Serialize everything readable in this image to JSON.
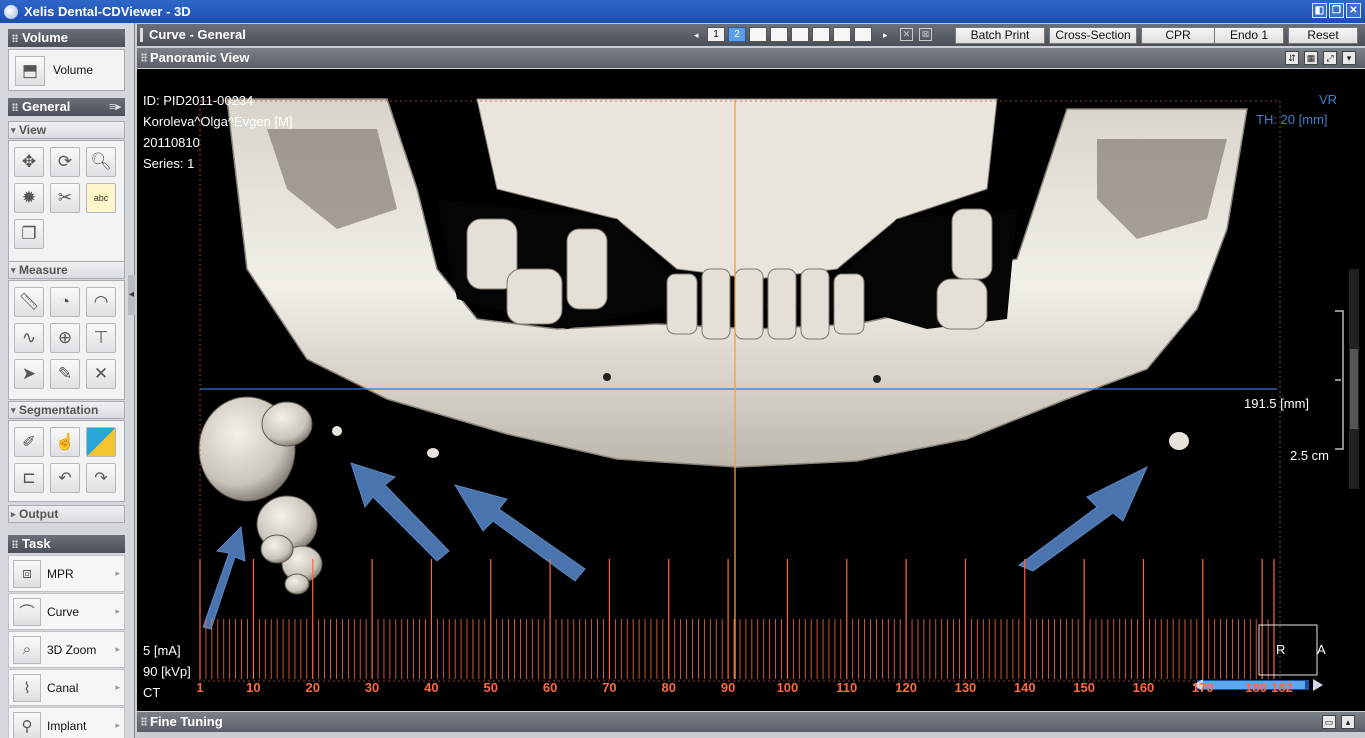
{
  "window": {
    "title": "Xelis Dental-CDViewer - 3D",
    "controls": [
      "◧",
      "❐",
      "✕"
    ]
  },
  "left_panel": {
    "volume_section": {
      "title": "Volume",
      "button_label": "Volume"
    },
    "general_section": {
      "title": "General",
      "view_label": "View",
      "view_tools": [
        "move-icon",
        "rotate-icon",
        "zoom-icon",
        "brightness-icon",
        "scissors-icon",
        "text-annotation-icon",
        "copy-icon"
      ],
      "text_tool_label": "abc",
      "measure_label": "Measure",
      "measure_tools": [
        "ruler-icon",
        "tape-measure-icon",
        "angle-icon",
        "profile-icon",
        "globe-icon",
        "pointer-label-icon",
        "arrow-cursor-icon",
        "eraser-icon",
        "delete-icon"
      ],
      "segmentation_label": "Segmentation",
      "segmentation_tools": [
        "pen-icon",
        "hand-select-icon",
        "layers-icon",
        "clip-icon",
        "undo-icon",
        "redo-icon"
      ],
      "output_label": "Output"
    },
    "task_section": {
      "title": "Task",
      "items": [
        {
          "label": "MPR",
          "icon": "mpr-icon"
        },
        {
          "label": "Curve",
          "icon": "curve-icon"
        },
        {
          "label": "3D Zoom",
          "icon": "3d-zoom-icon"
        },
        {
          "label": "Canal",
          "icon": "canal-icon"
        },
        {
          "label": "Implant",
          "icon": "implant-icon"
        }
      ]
    }
  },
  "toolbar": {
    "curve_title": "Curve - General",
    "pages": [
      "1",
      "2",
      "",
      "",
      "",
      "",
      "",
      ""
    ],
    "active_page": "2",
    "buttons": [
      "Batch Print",
      "Cross-Section",
      "CPR",
      "Endo 1",
      "Reset"
    ]
  },
  "view_header": {
    "title": "Panoramic View"
  },
  "viewport": {
    "patient_id": "ID: PID2011-00234",
    "patient_name": "Koroleva^Olga^Evgen [M]",
    "study_date": "20110810",
    "series": "Series: 1",
    "render_mode": "VR",
    "thickness": "TH: 20 [mm]",
    "length_label": "191.5 [mm]",
    "scale_label": "2.5 cm",
    "ma": "5 [mA]",
    "kvp": "90 [kVp]",
    "modality": "CT",
    "orientation_right": "R",
    "orientation_anterior": "A",
    "tick_labels": [
      "1",
      "10",
      "20",
      "30",
      "40",
      "50",
      "60",
      "70",
      "80",
      "90",
      "100",
      "110",
      "120",
      "130",
      "140",
      "150",
      "160",
      "170",
      "180",
      "182"
    ],
    "colors": {
      "ruler": "#ff6a3d",
      "cursor": "#f0a040",
      "guide": "#3a6fd8",
      "arrow": "#4a74ad"
    }
  },
  "fine_tuning": {
    "title": "Fine Tuning"
  }
}
